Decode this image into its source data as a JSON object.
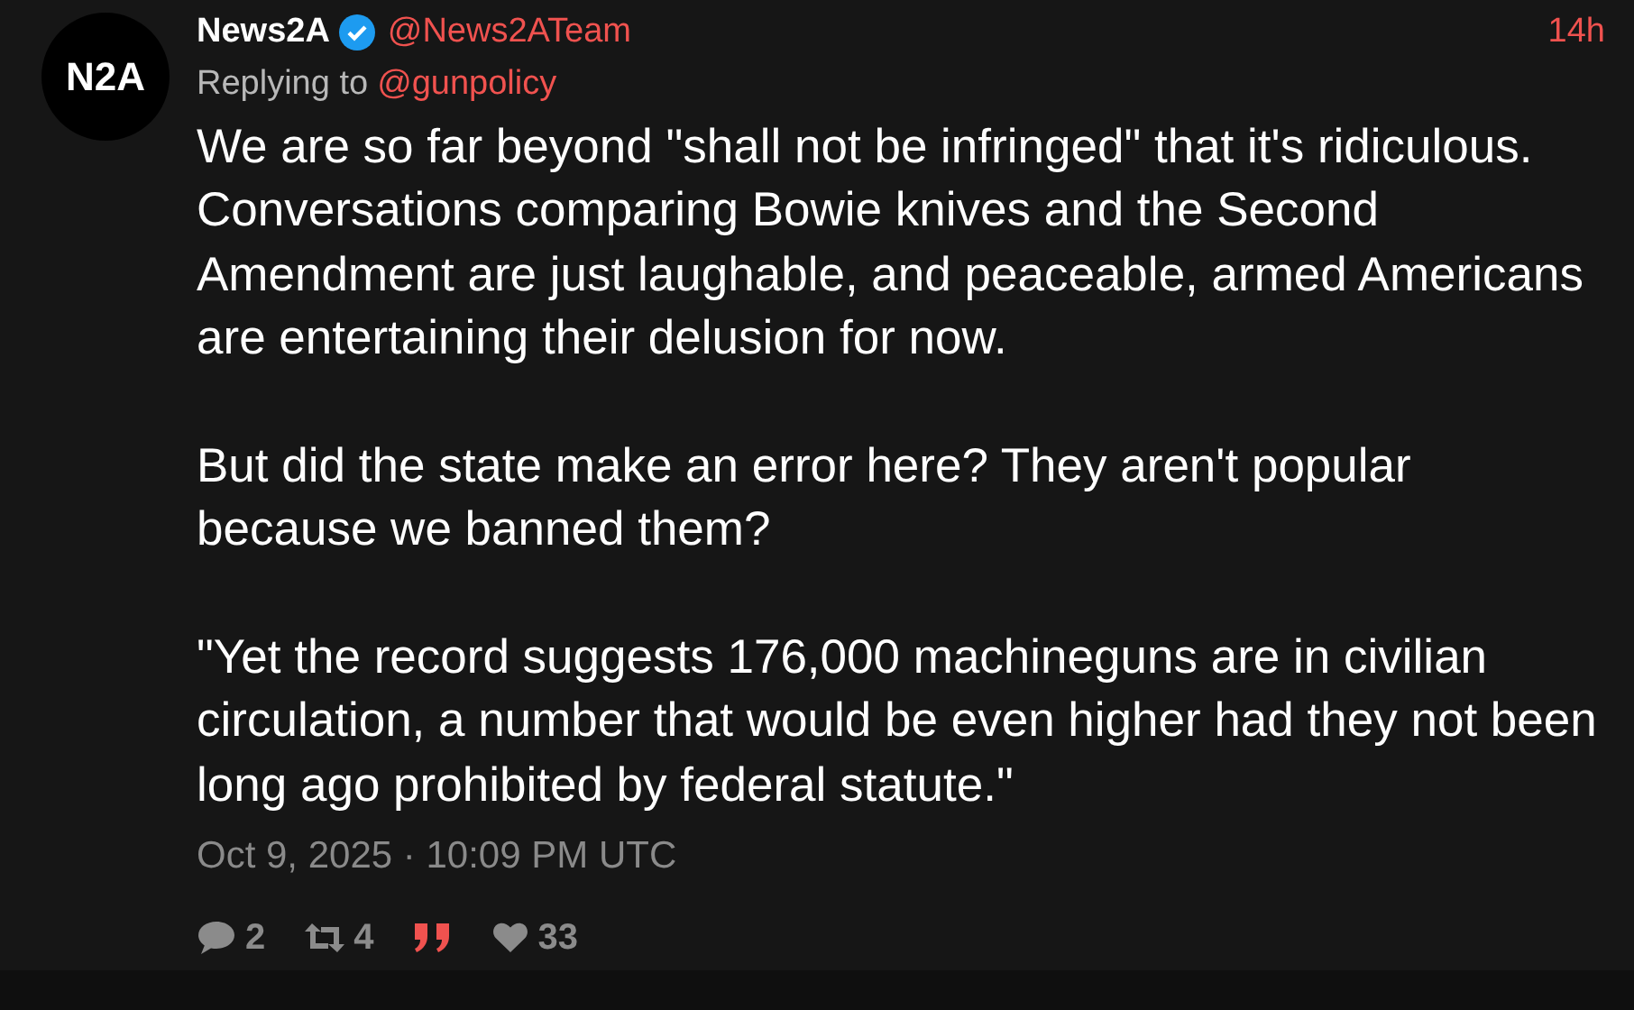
{
  "tweet": {
    "avatar_text": "N2A",
    "name": "News2A",
    "verified": true,
    "handle": "@News2ATeam",
    "time": "14h",
    "replying_label": "Replying to",
    "replying_to": "@gunpolicy",
    "paragraphs": [
      "We are so far beyond \"shall not be infringed\" that it's ridiculous. Conversations comparing Bowie knives and the Second Amendment are just laughable, and peaceable, armed Americans are entertaining their delusion for now.",
      "But did the state make an error here? They aren't popular because we banned them?",
      "\"Yet the record suggests 176,000 machineguns are in civilian circulation, a number that would be even higher had they not been long ago prohibited by federal statute.\""
    ],
    "date": "Oct 9, 2025 · 10:09 PM UTC",
    "stats": [
      {
        "kind": "reply",
        "count": "2"
      },
      {
        "kind": "retweet",
        "count": "4"
      },
      {
        "kind": "quote"
      },
      {
        "kind": "like",
        "count": "33"
      }
    ]
  }
}
